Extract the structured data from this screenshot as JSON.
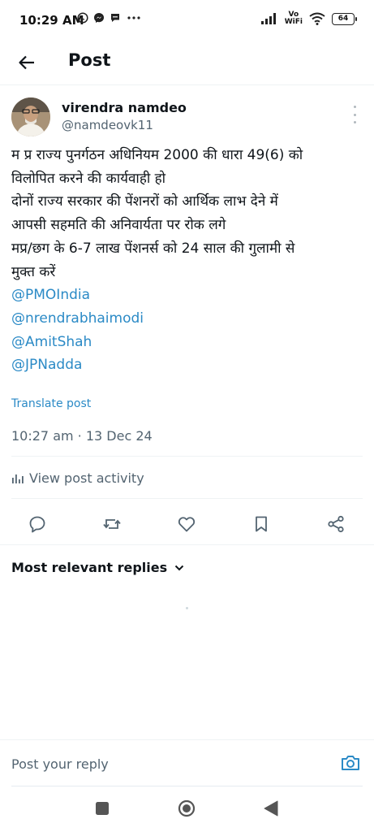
{
  "status_bar": {
    "time": "10:29 AM",
    "network_label": "Vo\nWiFi",
    "battery": "64"
  },
  "header": {
    "title": "Post"
  },
  "post": {
    "author_name": "virendra namdeo",
    "author_handle": "@namdeovk11",
    "lines": [
      "म प्र राज्य पुनर्गठन अधिनियम 2000 की धारा 49(6) को",
      "विलोपित करने की कार्यवाही हो",
      "दोनों राज्य सरकार की पेंशनरों को आर्थिक लाभ देने में",
      "आपसी सहमति की अनिवार्यता पर रोक लगे",
      "मप्र/छग के 6-7 लाख पेंशनर्स को 24 साल की गुलामी से",
      "मुक्त करें"
    ],
    "mentions": [
      "@PMOIndia",
      "@nrendrabhaimodi",
      "@AmitShah",
      "@JPNadda"
    ],
    "translate_label": "Translate post",
    "timestamp": "10:27 am · 13 Dec 24",
    "activity_label": "View post activity"
  },
  "replies": {
    "sort_label": "Most relevant replies"
  },
  "reply_bar": {
    "placeholder": "Post your reply"
  },
  "colors": {
    "link": "#2b8ac6",
    "secondary_text": "#536471",
    "primary_text": "#0f1419"
  }
}
